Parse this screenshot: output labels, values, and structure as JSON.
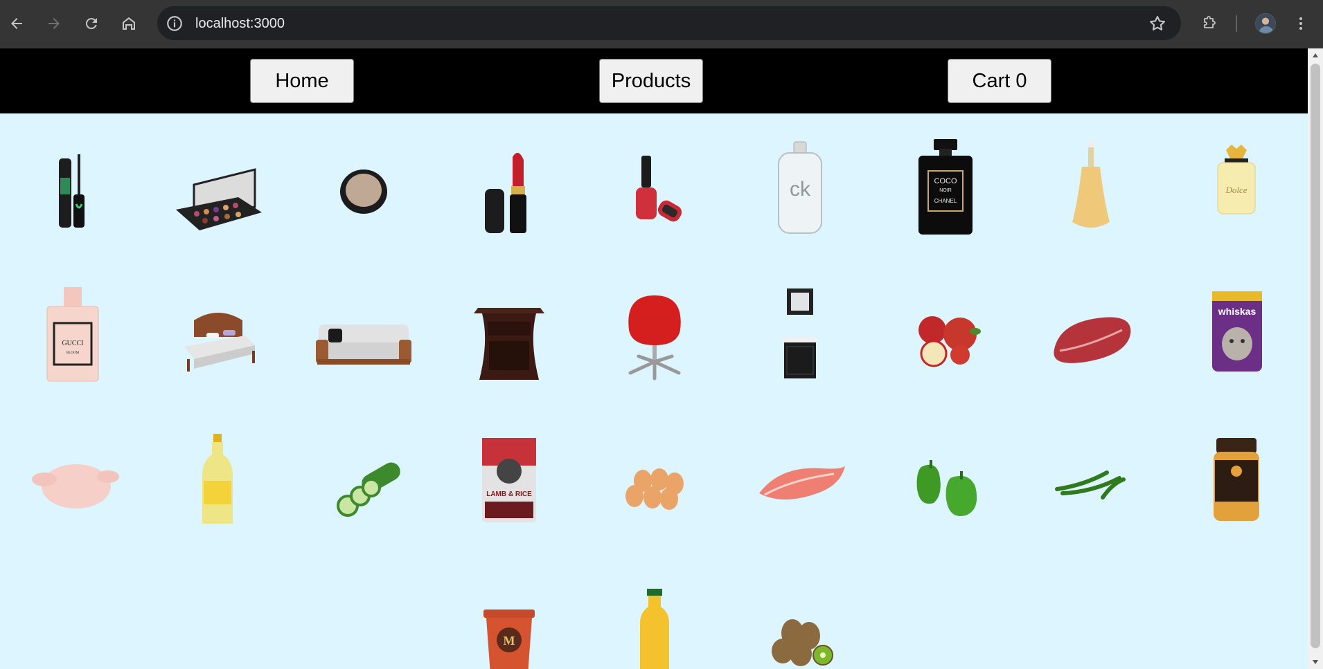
{
  "browser": {
    "url": "localhost:3000",
    "icons": [
      "back-arrow-icon",
      "forward-arrow-icon",
      "reload-icon",
      "home-icon",
      "site-info-icon",
      "bookmark-star-icon",
      "extensions-icon",
      "profile-avatar",
      "more-menu-icon"
    ]
  },
  "navbar": {
    "home_label": "Home",
    "products_label": "Products",
    "cart_label": "Cart 0"
  },
  "colors": {
    "page_background": "#ddf5ff",
    "navbar_background": "#000000",
    "button_background": "#f0f0f0"
  },
  "products": [
    {
      "icon": "mascara-icon"
    },
    {
      "icon": "eyeshadow-palette-icon"
    },
    {
      "icon": "compact-powder-icon"
    },
    {
      "icon": "lipstick-icon"
    },
    {
      "icon": "nail-polish-icon"
    },
    {
      "icon": "ck-perfume-icon"
    },
    {
      "icon": "chanel-perfume-icon"
    },
    {
      "icon": "gold-perfume-icon"
    },
    {
      "icon": "dolce-perfume-icon"
    },
    {
      "icon": "gucci-perfume-icon"
    },
    {
      "icon": "bed-icon"
    },
    {
      "icon": "sofa-icon"
    },
    {
      "icon": "nightstand-icon"
    },
    {
      "icon": "office-chair-icon"
    },
    {
      "icon": "bathroom-vanity-icon"
    },
    {
      "icon": "apples-icon"
    },
    {
      "icon": "steak-icon"
    },
    {
      "icon": "cat-food-icon"
    },
    {
      "icon": "raw-chicken-icon"
    },
    {
      "icon": "oil-bottle-icon"
    },
    {
      "icon": "cucumber-icon"
    },
    {
      "icon": "dog-food-bag-icon"
    },
    {
      "icon": "eggs-icon"
    },
    {
      "icon": "salmon-steak-icon"
    },
    {
      "icon": "green-peppers-icon"
    },
    {
      "icon": "chili-peppers-icon"
    },
    {
      "icon": "honey-jar-icon"
    },
    {
      "icon": "ice-cream-tub-icon"
    },
    {
      "icon": "orange-juice-icon"
    },
    {
      "icon": "kiwi-icon"
    }
  ],
  "product_texts": {
    "ck": "ck",
    "chanel_coco": "COCO",
    "chanel_noir": "NOIR",
    "chanel": "CHANEL",
    "gucci": "GUCCI",
    "gucci_sub": "BLOOM",
    "dolce": "Dolce",
    "whiskas": "whiskas",
    "dog_food": "LAMB & RICE",
    "magnum": "M"
  }
}
